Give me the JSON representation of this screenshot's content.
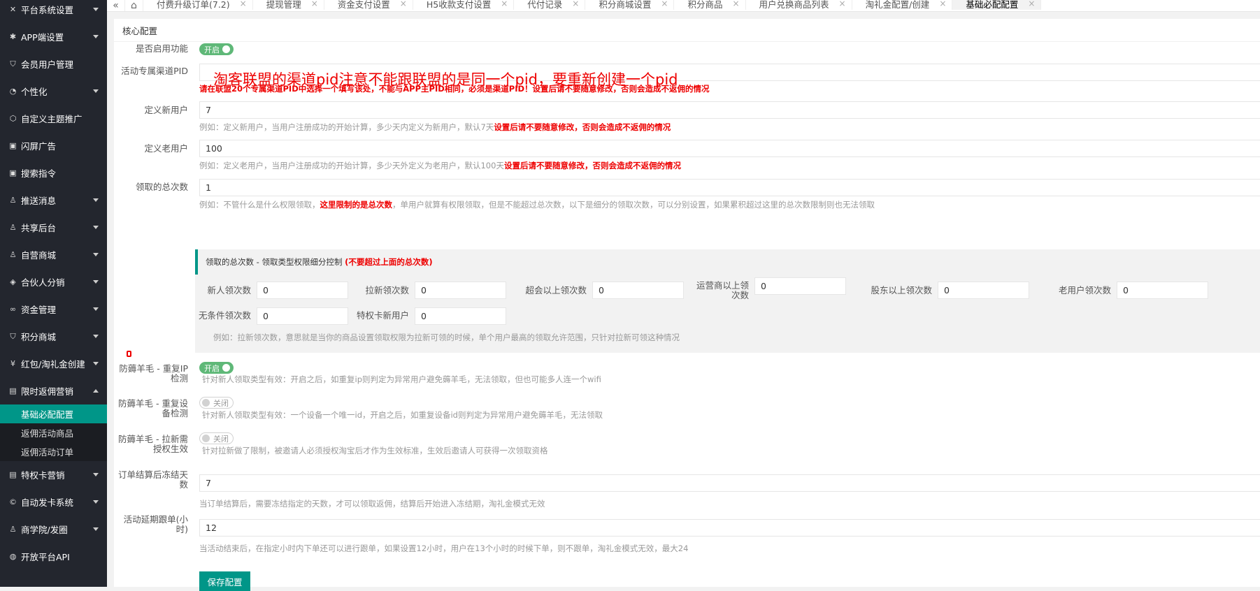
{
  "sidebar": {
    "items": [
      {
        "label": "平台系统设置",
        "icon": "tools-icon",
        "arrow": true
      },
      {
        "label": "APP端设置",
        "icon": "gear-icon",
        "arrow": true
      },
      {
        "label": "会员用户管理",
        "icon": "shield-icon",
        "arrow": false
      },
      {
        "label": "个性化",
        "icon": "palette-icon",
        "arrow": true
      },
      {
        "label": "自定义主题推广",
        "icon": "cube-icon",
        "arrow": false
      },
      {
        "label": "闪屏广告",
        "icon": "image-icon",
        "arrow": false
      },
      {
        "label": "搜索指令",
        "icon": "image-icon",
        "arrow": false
      },
      {
        "label": "推送消息",
        "icon": "user-icon",
        "arrow": true
      },
      {
        "label": "共享后台",
        "icon": "user-icon",
        "arrow": true
      },
      {
        "label": "自营商城",
        "icon": "user-icon",
        "arrow": true
      },
      {
        "label": "合伙人分销",
        "icon": "layers-icon",
        "arrow": true
      },
      {
        "label": "资金管理",
        "icon": "link-icon",
        "arrow": true
      },
      {
        "label": "积分商城",
        "icon": "shield-icon",
        "arrow": true
      },
      {
        "label": "红包/淘礼金创建",
        "icon": "yen-icon",
        "arrow": true
      },
      {
        "label": "限时返佣营销",
        "icon": "calendar-icon",
        "arrow": true,
        "open": true
      }
    ],
    "submenu": [
      {
        "label": "基础必配配置",
        "active": true
      },
      {
        "label": "返佣活动商品",
        "active": false
      },
      {
        "label": "返佣活动订单",
        "active": false
      }
    ],
    "items_after": [
      {
        "label": "特权卡营销",
        "icon": "calendar-icon",
        "arrow": true
      },
      {
        "label": "自动发卡系统",
        "icon": "copyright-icon",
        "arrow": true
      },
      {
        "label": "商学院/发圈",
        "icon": "user-icon",
        "arrow": true
      },
      {
        "label": "开放平台API",
        "icon": "globe-icon",
        "arrow": false
      }
    ]
  },
  "tabs": {
    "back_icon": "double-chevron-left-icon",
    "home_icon": "home-icon",
    "items": [
      {
        "label": "付费升级订单(7.2)",
        "active": false
      },
      {
        "label": "提现管理",
        "active": false
      },
      {
        "label": "资金支付设置",
        "active": false
      },
      {
        "label": "H5收款支付设置",
        "active": false
      },
      {
        "label": "代付记录",
        "active": false
      },
      {
        "label": "积分商城设置",
        "active": false
      },
      {
        "label": "积分商品",
        "active": false
      },
      {
        "label": "用户兑换商品列表",
        "active": false
      },
      {
        "label": "淘礼金配置/创建",
        "active": false
      },
      {
        "label": "基础必配配置",
        "active": true
      }
    ],
    "close_glyph": "×"
  },
  "card": {
    "title": "核心配置"
  },
  "overlay_note": "淘客联盟的渠道pid注意不能跟联盟的是同一个pid，要重新创建一个pid",
  "form": {
    "enable": {
      "label": "是否启用功能",
      "state": "开启"
    },
    "pid": {
      "label": "活动专属渠道PID",
      "value": "",
      "tip": "请在联盟20个专属渠道PID中选择一个填写该处，不能与APP主PID相同，必须是渠道PID！设置后请不要随意修改，否则会造成不返佣的情况"
    },
    "new_user": {
      "label": "定义新用户",
      "value": "7",
      "tip": "例如：定义新用户，当用户注册成功的开始计算，多少天内定义为新用户，默认7天",
      "tip_red": "设置后请不要随意修改，否则会造成不返佣的情况"
    },
    "old_user": {
      "label": "定义老用户",
      "value": "100",
      "tip": "例如：定义老用户，当用户注册成功的开始计算，多少天外定义为老用户，默认100天",
      "tip_red": "设置后请不要随意修改，否则会造成不返佣的情况"
    },
    "total": {
      "label": "领取的总次数",
      "value": "1",
      "tip_a": "例如：不管什么是什么权限领取，",
      "tip_red": "这里限制的是总次数",
      "tip_b": "，单用户就算有权限领取，但是不能超过总次数，以下是细分的领取次数，可以分别设置，如果累积超过这里的总次数限制则也无法领取"
    },
    "detail": {
      "head": "领取的总次数 - 领取类型权限细分控制",
      "head_red": "(不要超过上面的总次数)",
      "fields": [
        {
          "label": "新人领次数",
          "value": "0"
        },
        {
          "label": "拉新领次数",
          "value": "0"
        },
        {
          "label": "超会以上领次数",
          "value": "0"
        },
        {
          "label": "运营商以上领次数",
          "value": "0"
        },
        {
          "label": "股东以上领次数",
          "value": "0"
        },
        {
          "label": "老用户领次数",
          "value": "0"
        },
        {
          "label": "无条件领次数",
          "value": "0"
        },
        {
          "label": "特权卡新用户",
          "value": "0"
        }
      ],
      "tip": "例如：拉新领次数，意思就是当你的商品设置领取权限为拉新可领的时候，单个用户最高的领取允许范围，只针对拉新可领这种情况"
    },
    "ip_check": {
      "label": "防薅羊毛 - 重复IP检测",
      "state": "开启",
      "tip": "针对新人领取类型有效：开启之后，如重复ip则判定为异常用户避免薅羊毛，无法领取，但也可能多人连一个wifi"
    },
    "device_check": {
      "label": "防薅羊毛 - 重复设备检测",
      "state": "关闭",
      "tip": "针对新人领取类型有效：一个设备一个唯一id，开启之后，如重复设备id则判定为异常用户避免薅羊毛，无法领取"
    },
    "auth_check": {
      "label": "防薅羊毛 - 拉新需授权生效",
      "state": "关闭",
      "tip": "针对拉新做了限制，被邀请人必须授权淘宝后才作为生效标准，生效后邀请人可获得一次领取资格"
    },
    "freeze": {
      "label": "订单结算后冻结天数",
      "value": "7",
      "tip": "当订单结算后，需要冻结指定的天数，才可以领取返佣，结算后开始进入冻结期，淘礼金模式无效"
    },
    "delay": {
      "label": "活动延期跟单(小时)",
      "value": "12",
      "tip": "当活动结束后，在指定小时内下单还可以进行跟单，如果设置12小时，用户在13个小时的时候下单，则不跟单，淘礼金模式无效，最大24"
    },
    "save_label": "保存配置"
  }
}
